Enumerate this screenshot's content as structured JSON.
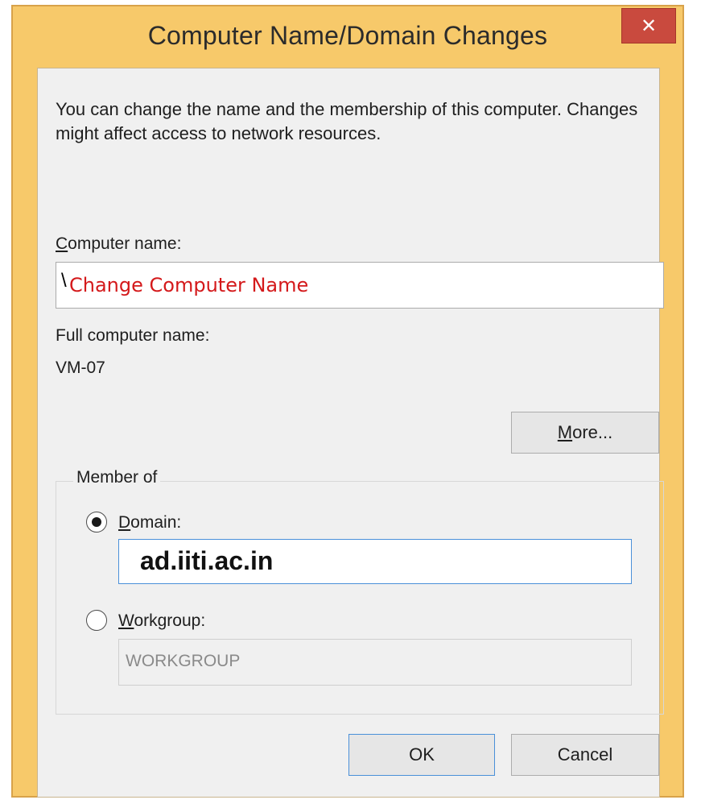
{
  "window": {
    "title": "Computer Name/Domain Changes",
    "close_glyph": "✕"
  },
  "description": "You can change the name and the membership of this computer. Changes might affect access to network resources.",
  "computer_name": {
    "label_mnemonic": "C",
    "label_rest": "omputer name:",
    "prefix": "\\",
    "value": "Change Computer Name",
    "value_color": "#d4191b"
  },
  "full_computer_name": {
    "label": "Full computer name:",
    "value": "VM-07"
  },
  "more_button": {
    "mnemonic": "M",
    "rest": "ore..."
  },
  "member_of": {
    "legend": "Member of",
    "domain": {
      "mnemonic": "D",
      "rest": "omain:",
      "selected": true,
      "value": "ad.iiti.ac.in"
    },
    "workgroup": {
      "mnemonic": "W",
      "rest": "orkgroup:",
      "selected": false,
      "value": "WORKGROUP"
    }
  },
  "buttons": {
    "ok": "OK",
    "cancel": "Cancel"
  },
  "colors": {
    "title_bar": "#f7c96a",
    "close_button": "#c94a3e",
    "focus_border": "#4a90d9"
  },
  "icons": {
    "close": "close-icon",
    "radio_selected": "radio-selected-icon",
    "radio_unselected": "radio-unselected-icon"
  }
}
